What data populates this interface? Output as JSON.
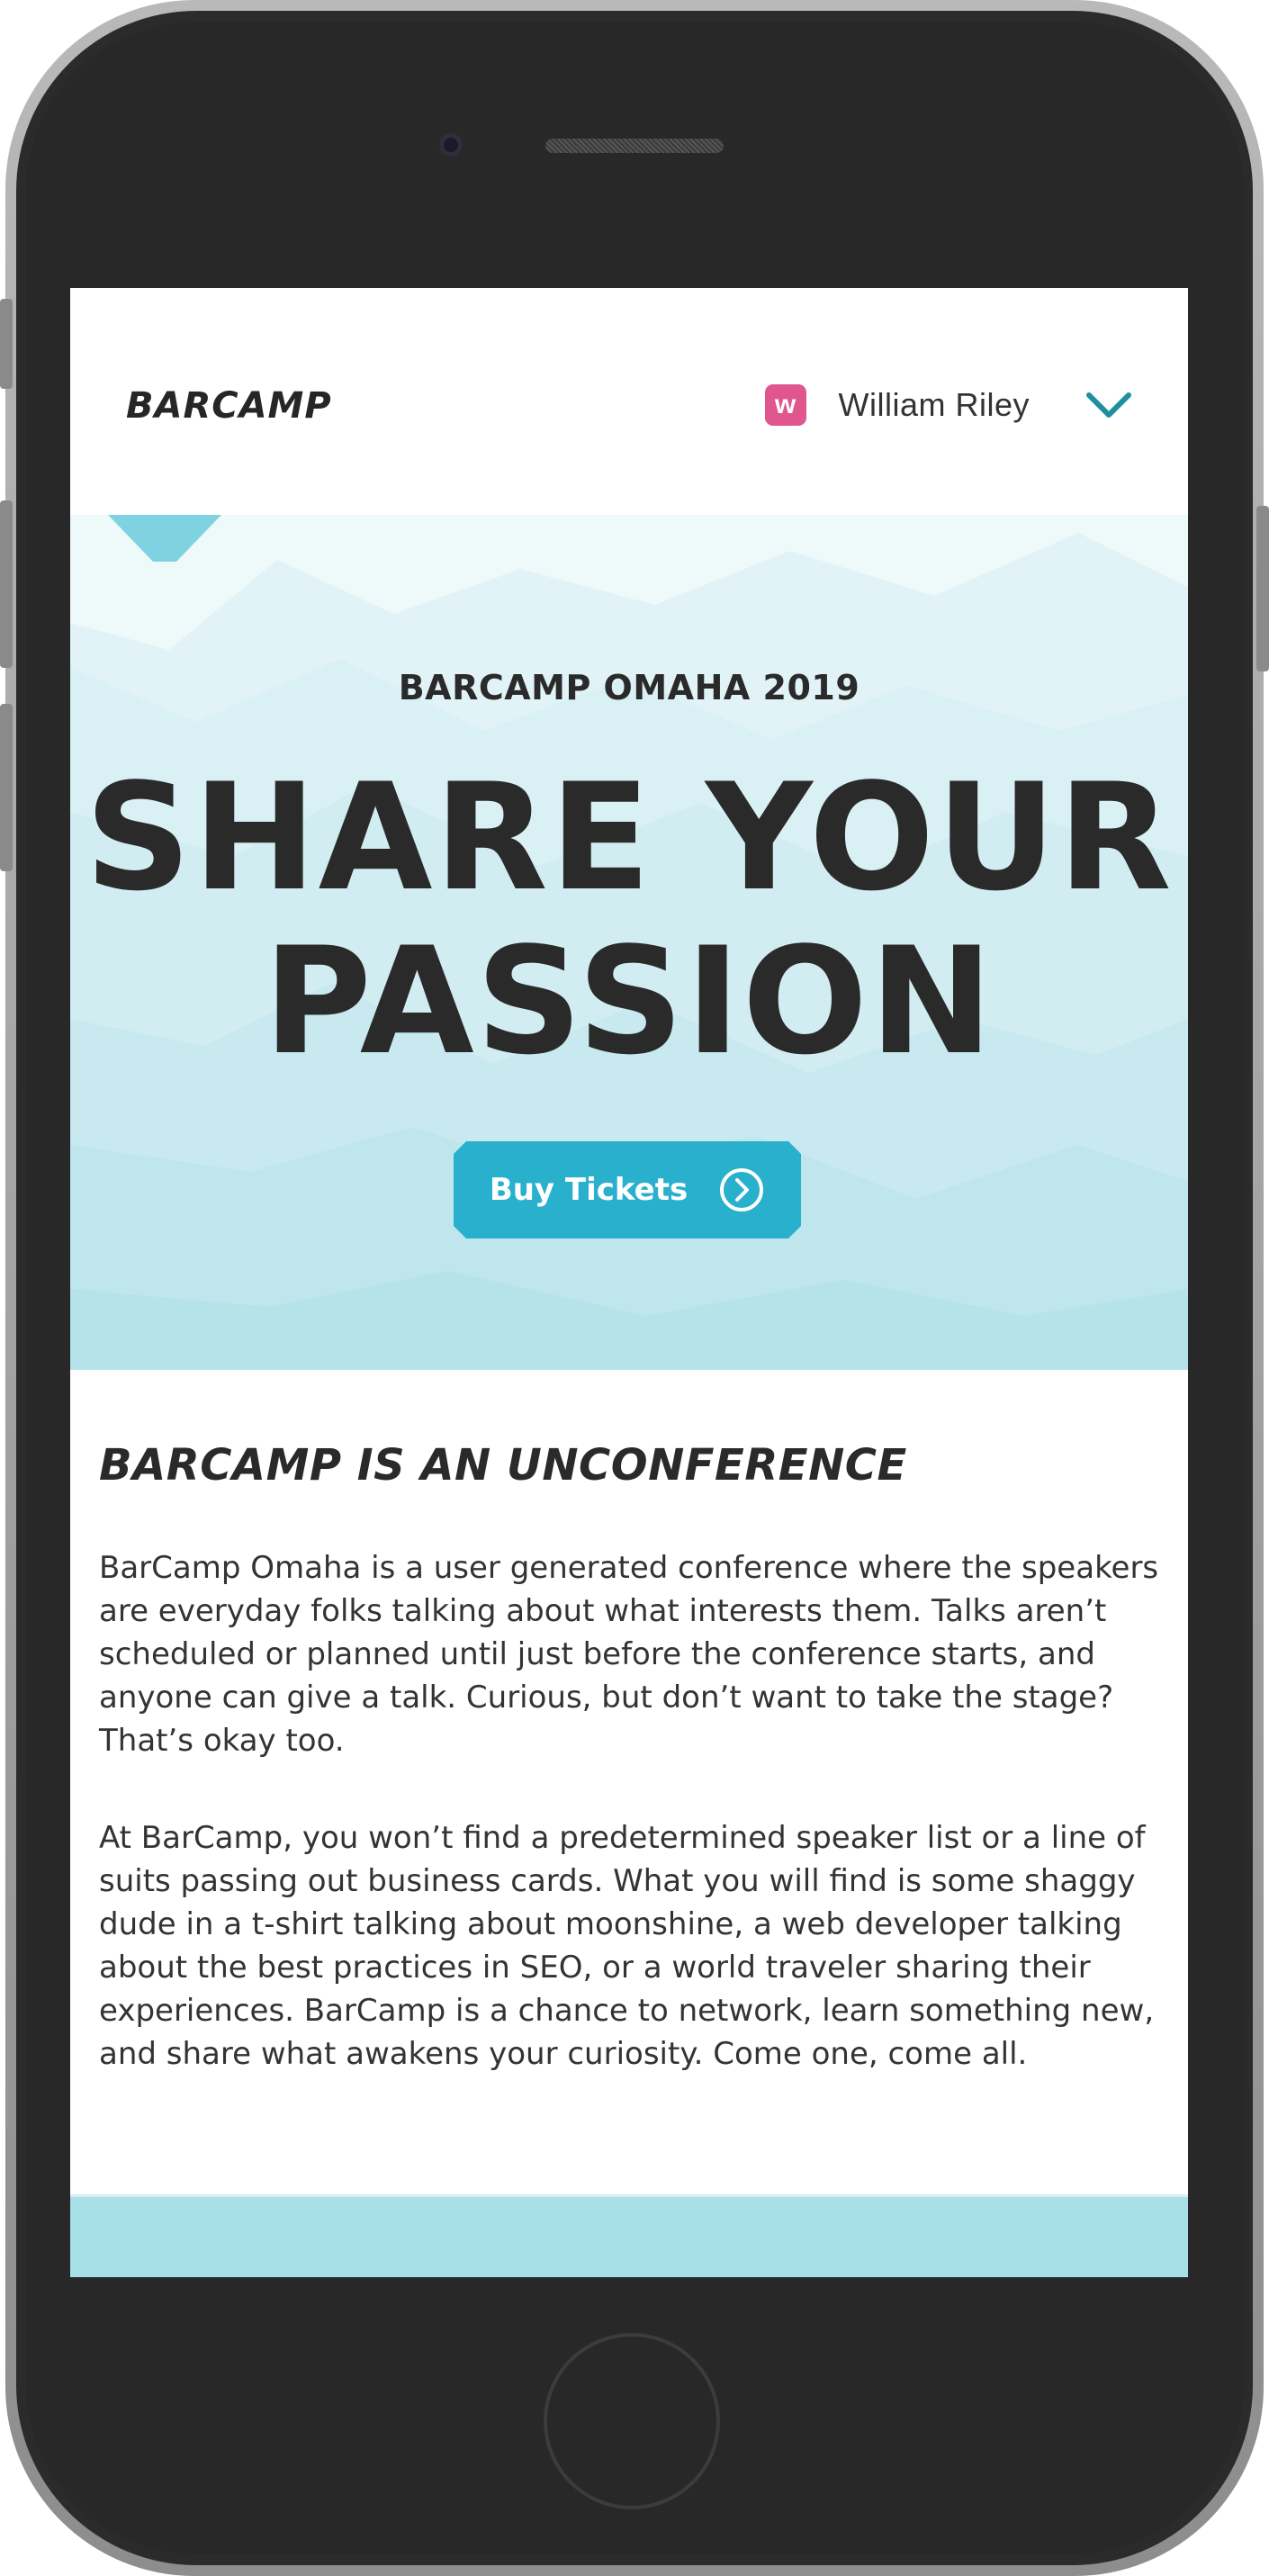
{
  "header": {
    "logo": "BARCAMP",
    "user": {
      "avatar_initial": "w",
      "name": "William Riley"
    }
  },
  "hero": {
    "eyebrow": "BARCAMP OMAHA 2019",
    "headline_line1": "SHARE YOUR",
    "headline_line2": "PASSION",
    "cta_label": "Buy Tickets"
  },
  "about": {
    "title": "BARCAMP IS AN UNCONFERENCE",
    "paragraph1": "BarCamp Omaha is a user generated conference where the speakers are everyday folks talking about what interests them. Talks aren’t scheduled or planned until just before the conference starts, and anyone can give a talk. Curious, but don’t want to take the stage? That’s okay too.",
    "paragraph2": "At BarCamp, you won’t find a predetermined speaker list or a line of suits passing out business cards. What you will find is some shaggy dude in a t-shirt talking about moonshine, a web developer talking about the best practices in SEO, or a world traveler sharing their experiences. BarCamp is a chance to network, learn something new, and share what awakens your curiosity. Come one, come all."
  },
  "colors": {
    "accent": "#28b0cc",
    "avatar": "#e0568f",
    "chevron": "#1f8fa0",
    "text": "#2a2a2a"
  },
  "icons": {
    "user_menu": "chevron-down-icon",
    "cta": "arrow-right-circle-icon"
  }
}
